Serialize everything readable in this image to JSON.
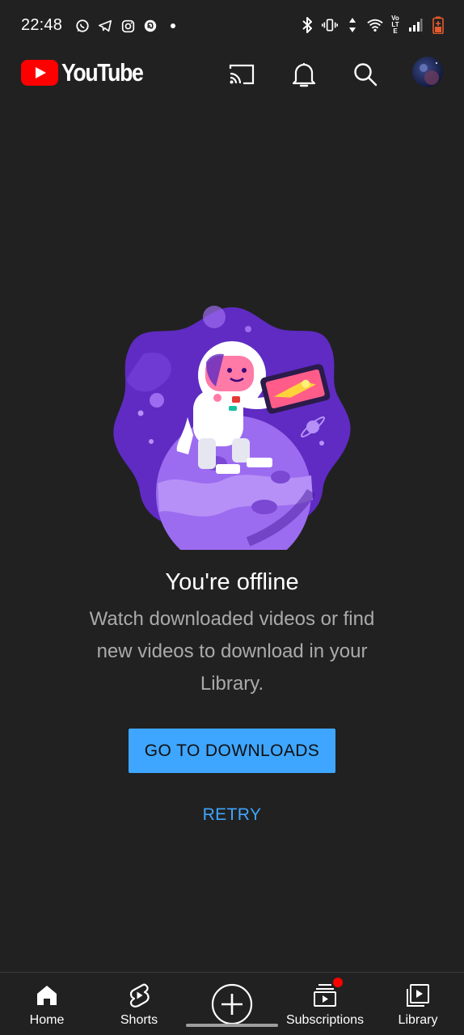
{
  "status_bar": {
    "time": "22:48",
    "left_icons": [
      "whatsapp-icon",
      "telegram-icon",
      "instagram-icon",
      "threads-icon",
      "dot-icon"
    ],
    "right_icons": [
      "bluetooth-icon",
      "vibrate-icon",
      "data-arrows-icon",
      "wifi-icon",
      "volte-icon",
      "signal-icon",
      "battery-icon"
    ],
    "volte_text": "Vo LTE"
  },
  "header": {
    "logo_text": "YouTube",
    "brand_color": "#ff0000",
    "icons": [
      "cast-icon",
      "notifications-icon",
      "search-icon",
      "account-avatar"
    ]
  },
  "offline": {
    "title": "You're offline",
    "message": "Watch downloaded videos or find new videos to download in your Library.",
    "primary_button": "GO TO DOWNLOADS",
    "secondary_button": "RETRY",
    "accent_color": "#3ea6ff"
  },
  "bottom_nav": {
    "items": [
      {
        "label": "Home",
        "icon": "home-icon",
        "active": true
      },
      {
        "label": "Shorts",
        "icon": "shorts-icon",
        "active": false
      },
      {
        "label": "",
        "icon": "create-icon",
        "active": false
      },
      {
        "label": "Subscriptions",
        "icon": "subscriptions-icon",
        "active": false,
        "has_notification_dot": true
      },
      {
        "label": "Library",
        "icon": "library-icon",
        "active": false
      }
    ]
  }
}
